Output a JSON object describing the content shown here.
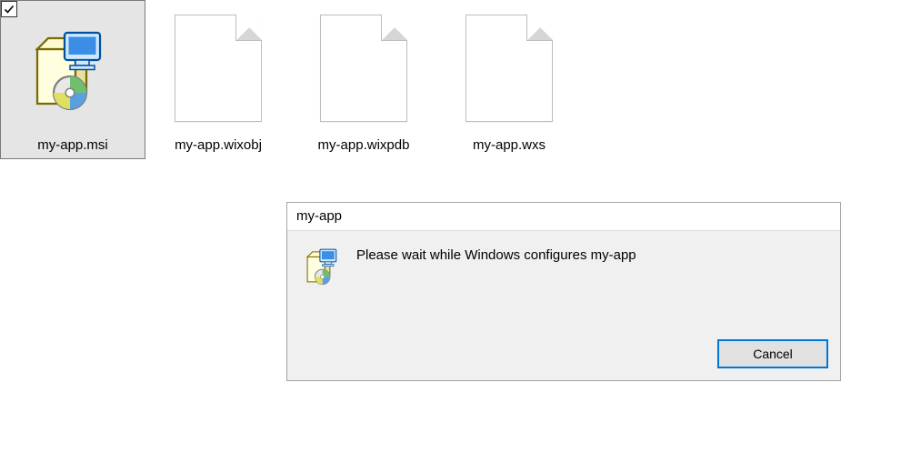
{
  "files": [
    {
      "name": "my-app.msi",
      "kind": "installer",
      "selected": true
    },
    {
      "name": "my-app.wixobj",
      "kind": "generic",
      "selected": false
    },
    {
      "name": "my-app.wixpdb",
      "kind": "generic",
      "selected": false
    },
    {
      "name": "my-app.wxs",
      "kind": "generic",
      "selected": false
    }
  ],
  "dialog": {
    "title": "my-app",
    "message": "Please wait while Windows configures my-app",
    "cancel_label": "Cancel"
  },
  "icons": {
    "installer": "installer-icon",
    "generic": "blank-file-icon",
    "checkmark": "checkmark-icon"
  }
}
